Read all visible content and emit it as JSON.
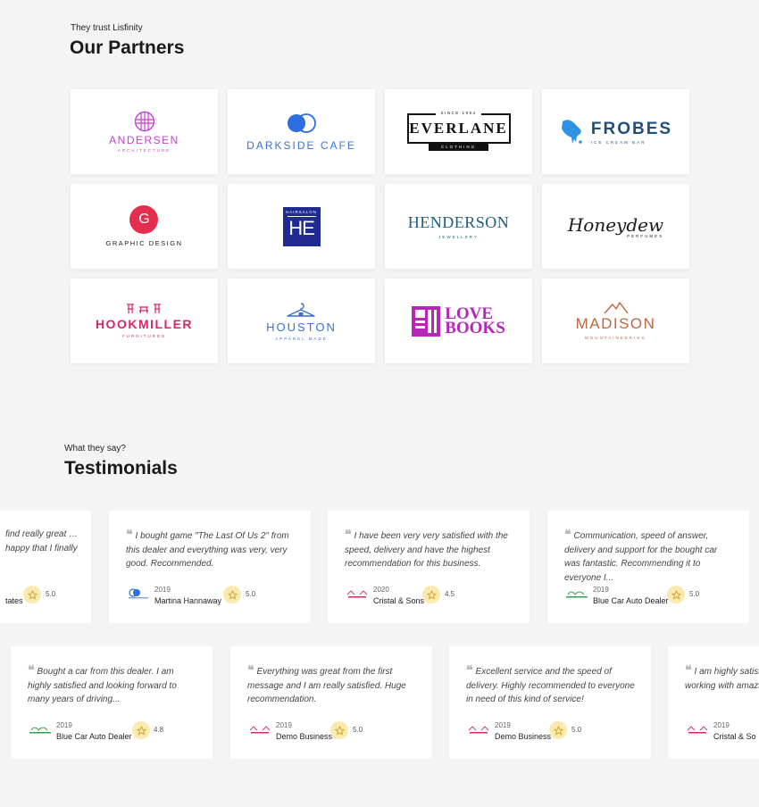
{
  "partners": {
    "eyebrow": "They trust Lisfinity",
    "title": "Our Partners",
    "logos": [
      {
        "name": "ANDERSEN",
        "tagline": "ARCHITECTURE",
        "color": "#c73fd0"
      },
      {
        "name": "DARKSIDE CAFE",
        "color": "#3a74d9"
      },
      {
        "name": "EVERLANE",
        "top": "SINCE 1984",
        "tagline": "CLOTHING",
        "color": "#111111"
      },
      {
        "name": "FROBES",
        "tagline": "ICE CREAM BAR",
        "color": "#1f4f7a",
        "accent": "#2e93e3"
      },
      {
        "name": "GRAPHIC DESIGN",
        "mark": "G",
        "color": "#222222",
        "accent": "#e52e4e"
      },
      {
        "name": "HAIRSALON",
        "mark": "HE",
        "color": "#1f2b8f"
      },
      {
        "name": "HENDERSON",
        "tagline": "JEWELLERY",
        "color": "#1d5d80"
      },
      {
        "name": "Honeydew",
        "tagline": "PERFUMES",
        "color": "#1a1a1a"
      },
      {
        "name": "HOOKMILLER",
        "tagline": "FURNITURES",
        "color": "#d9256c"
      },
      {
        "name": "HOUSTON",
        "tagline": "APPAREL MADE",
        "color": "#3a6fd9"
      },
      {
        "name": "LOVE",
        "name2": "BOOKS",
        "color": "#b626b8"
      },
      {
        "name": "MADISON",
        "tagline": "MOUNTAINEERING",
        "color": "#c0653d"
      }
    ]
  },
  "testimonials": {
    "eyebrow": "What they say?",
    "title": "Testimonials",
    "row1": [
      {
        "quote": "find really great … happy that I finally",
        "year": "",
        "company": "tates",
        "rating": "5.0"
      },
      {
        "quote": "I bought game \"The Last Of Us 2\" from this dealer and everything was very, very good. Recommended.",
        "year": "2019",
        "company": "Martina Hannaway",
        "rating": "5.0"
      },
      {
        "quote": "I have been very very satisfied with the speed, delivery and have the highest recommendation for this business.",
        "year": "2020",
        "company": "Cristal & Sons",
        "rating": "4.5"
      },
      {
        "quote": "Communication, speed of answer, delivery and support for the bought car was fantastic. Recommending it to everyone I...",
        "year": "2019",
        "company": "Blue Car Auto Dealer",
        "rating": "5.0"
      }
    ],
    "row2": [
      {
        "quote": "Bought a car from this dealer. I am highly satisfied and looking forward to many years of driving...",
        "year": "2019",
        "company": "Blue Car Auto Dealer",
        "rating": "4.8"
      },
      {
        "quote": "Everything was great from the first message and I am really satisfied. Huge recommendation.",
        "year": "2019",
        "company": "Demo Business",
        "rating": "5.0"
      },
      {
        "quote": "Excellent service and the speed of delivery. Highly recommended to everyone in need of this kind of service!",
        "year": "2019",
        "company": "Demo Business",
        "rating": "5.0"
      },
      {
        "quote": "I am highly satisfied, experience working with amazing agent. Re...",
        "year": "2019",
        "company": "Cristal & So",
        "rating": "5.0"
      }
    ]
  }
}
